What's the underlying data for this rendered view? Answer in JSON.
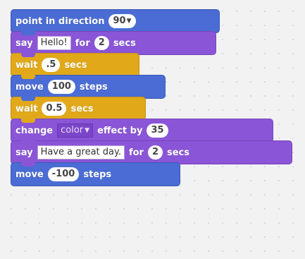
{
  "colors": {
    "motion": "#4a6cd4",
    "looks": "#8a55d7",
    "control": "#e1a91a",
    "canvas": "#f2f2f2"
  },
  "blocks": [
    {
      "kw1": "point in direction",
      "value": "90",
      "arrow": "▼"
    },
    {
      "kw1": "say",
      "text": "Hello!",
      "kw2": "for",
      "value": "2",
      "kw3": "secs"
    },
    {
      "kw1": "wait",
      "value": ".5",
      "kw2": "secs"
    },
    {
      "kw1": "move",
      "value": "100",
      "kw2": "steps"
    },
    {
      "kw1": "wait",
      "value": "0.5",
      "kw2": "secs"
    },
    {
      "kw1": "change",
      "dropdown": "color",
      "arrow": "▼",
      "kw2": "effect by",
      "value": "35"
    },
    {
      "kw1": "say",
      "text": "Have a great day.",
      "kw2": "for",
      "value": "2",
      "kw3": "secs"
    },
    {
      "kw1": "move",
      "value": "-100",
      "kw2": "steps"
    }
  ]
}
